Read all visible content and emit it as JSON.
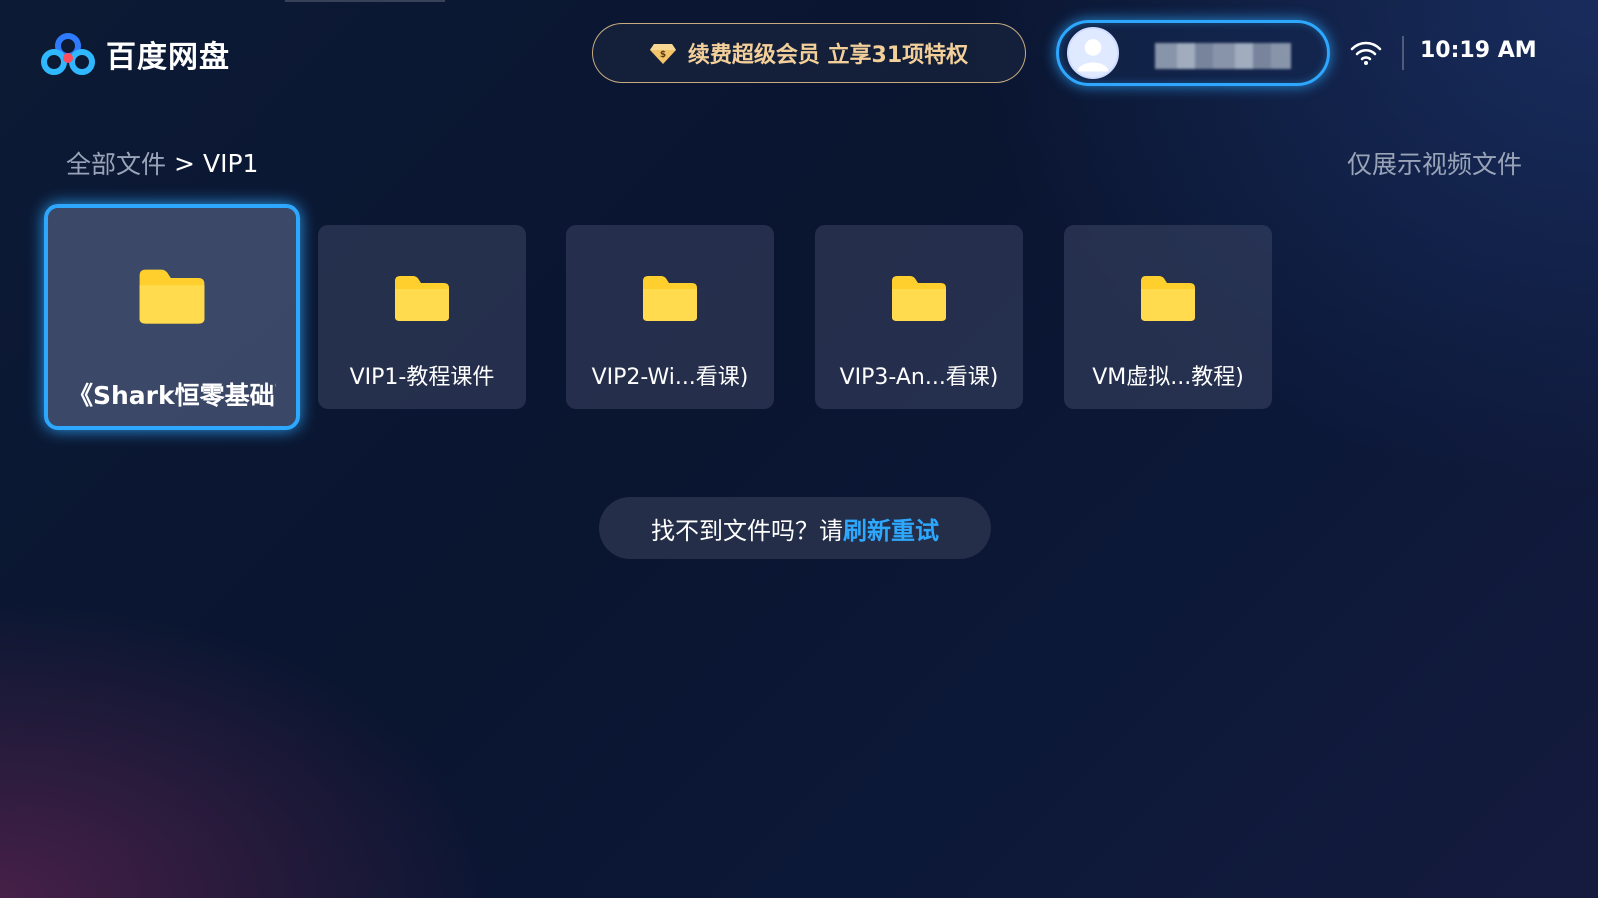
{
  "app": {
    "title": "百度网盘"
  },
  "header": {
    "vip_banner": "续费超级会员 立享31项特权",
    "time": "10:19 AM"
  },
  "breadcrumb": {
    "root": "全部文件",
    "separator": ">",
    "current": "VIP1"
  },
  "filter": {
    "video_only": "仅展示视频文件"
  },
  "folders": [
    {
      "name": "《Shark恒零基础百",
      "focused": true
    },
    {
      "name": "VIP1-教程课件",
      "focused": false
    },
    {
      "name": "VIP2-Wi...看课)",
      "focused": false
    },
    {
      "name": "VIP3-An...看课)",
      "focused": false
    },
    {
      "name": "VM虚拟...教程)",
      "focused": false
    }
  ],
  "refresh": {
    "prompt": "找不到文件吗？请",
    "link": "刷新重试"
  },
  "colors": {
    "accent": "#2ea8ff",
    "vip_gold": "#f3d09a",
    "folder_yellow": "#ffd43b"
  },
  "icons": {
    "logo": "baidu-netdisk-logo",
    "vip": "diamond-icon",
    "wifi": "wifi-icon",
    "folder": "folder-icon",
    "avatar": "user-avatar"
  }
}
